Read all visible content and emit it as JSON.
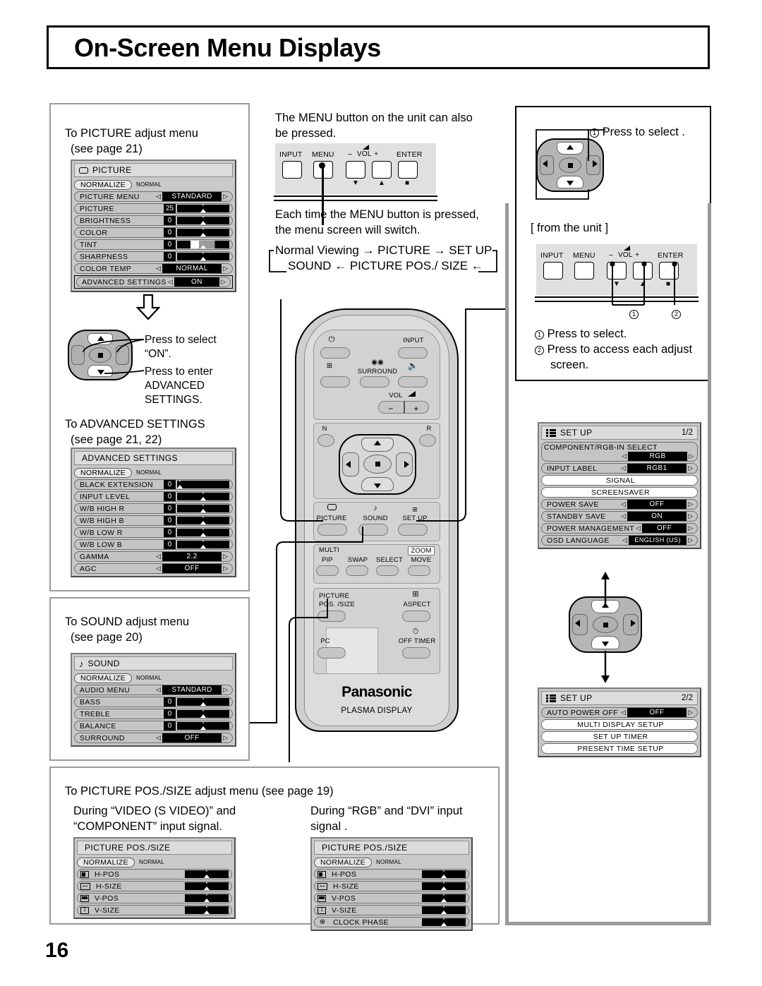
{
  "page": {
    "title": "On-Screen Menu Displays",
    "number": "16"
  },
  "left_column": {
    "picture_caption_l1": "To PICTURE adjust menu",
    "picture_caption_l2": "(see page 21)",
    "advanced_caption_l1": "To ADVANCED SETTINGS",
    "advanced_caption_l2": "(see page 21, 22)",
    "sound_caption_l1": "To SOUND adjust menu",
    "sound_caption_l2": "(see page 20)",
    "dpad_note_1": "Press to select",
    "dpad_note_2": "“ON”.",
    "dpad_note_3": "Press to enter",
    "dpad_note_4": "ADVANCED",
    "dpad_note_5": "SETTINGS."
  },
  "center_column": {
    "menu_note_l1": "The MENU button on the unit can also",
    "menu_note_l2": "be pressed.",
    "switch_note_l1": "Each time the MENU button is pressed,",
    "switch_note_l2": "the menu screen will switch.",
    "flow_line1": "Normal Viewing → PICTURE → SET UP",
    "flow_line2": "SOUND ← PICTURE POS./ SIZE ←"
  },
  "right_column": {
    "select_note": "Press to select .",
    "select_note_num": "1",
    "from_unit": "[ from the unit ]",
    "step1_num": "1",
    "step1": "Press to select.",
    "step2_num": "2",
    "step2_l1": "Press to access each adjust",
    "step2_l2": "screen.",
    "callout_1": "1",
    "callout_2": "2"
  },
  "bottom": {
    "caption": "To PICTURE POS./SIZE adjust menu (see page 19)",
    "left_note_l1": "During “VIDEO (S VIDEO)” and",
    "left_note_l2": "“COMPONENT” input signal.",
    "right_note_l1": "During “RGB” and “DVI” input",
    "right_note_l2": "signal ."
  },
  "unit_strip": {
    "labels": [
      "INPUT",
      "MENU",
      "VOL",
      "ENTER"
    ],
    "vol_minus": "−",
    "vol_plus": "+"
  },
  "osd": {
    "picture": {
      "title": "PICTURE",
      "normalize": "NORMALIZE",
      "normal_tag": "NORMAL",
      "rows": [
        {
          "label": "PICTURE  MENU",
          "type": "select",
          "value": "STANDARD"
        },
        {
          "label": "PICTURE",
          "type": "slider",
          "value": "25"
        },
        {
          "label": "BRIGHTNESS",
          "type": "slider",
          "value": "0"
        },
        {
          "label": "COLOR",
          "type": "slider",
          "value": "0"
        },
        {
          "label": "TINT",
          "type": "slider-tint",
          "value": "0"
        },
        {
          "label": "SHARPNESS",
          "type": "slider",
          "value": "0"
        },
        {
          "label": "COLOR  TEMP",
          "type": "select",
          "value": "NORMAL"
        },
        {
          "label": "ADVANCED  SETTINGS",
          "type": "select",
          "value": "ON",
          "highlight": true
        }
      ]
    },
    "advanced": {
      "title": "ADVANCED  SETTINGS",
      "normalize": "NORMALIZE",
      "normal_tag": "NORMAL",
      "rows": [
        {
          "label": "BLACK  EXTENSION",
          "type": "slider",
          "value": "0"
        },
        {
          "label": "INPUT LEVEL",
          "type": "slider",
          "value": "0"
        },
        {
          "label": "W/B  HIGH  R",
          "type": "slider",
          "value": "0"
        },
        {
          "label": "W/B  HIGH  B",
          "type": "slider",
          "value": "0"
        },
        {
          "label": "W/B  LOW  R",
          "type": "slider",
          "value": "0"
        },
        {
          "label": "W/B  LOW  B",
          "type": "slider",
          "value": "0"
        },
        {
          "label": "GAMMA",
          "type": "select",
          "value": "2.2"
        },
        {
          "label": "AGC",
          "type": "select",
          "value": "OFF"
        }
      ]
    },
    "sound": {
      "title": "SOUND",
      "normalize": "NORMALIZE",
      "normal_tag": "NORMAL",
      "rows": [
        {
          "label": "AUDIO  MENU",
          "type": "select",
          "value": "STANDARD"
        },
        {
          "label": "BASS",
          "type": "slider",
          "value": "0"
        },
        {
          "label": "TREBLE",
          "type": "slider",
          "value": "0"
        },
        {
          "label": "BALANCE",
          "type": "slider",
          "value": "0"
        },
        {
          "label": "SURROUND",
          "type": "select",
          "value": "OFF"
        }
      ]
    },
    "setup1": {
      "title": "SET UP",
      "page": "1/2",
      "rows": [
        {
          "label": "COMPONENT/RGB-IN  SELECT",
          "type": "select-tall",
          "value": "RGB"
        },
        {
          "label": "INPUT LABEL",
          "type": "select",
          "value": "RGB1"
        },
        {
          "label": "SIGNAL",
          "type": "plain"
        },
        {
          "label": "SCREENSAVER",
          "type": "plain"
        },
        {
          "label": "POWER SAVE",
          "type": "select",
          "value": "OFF"
        },
        {
          "label": "STANDBY SAVE",
          "type": "select",
          "value": "ON"
        },
        {
          "label": "POWER MANAGEMENT",
          "type": "select",
          "value": "OFF"
        },
        {
          "label": "OSD  LANGUAGE",
          "type": "select",
          "value": "ENGLISH (US)"
        }
      ]
    },
    "setup2": {
      "title": "SET UP",
      "page": "2/2",
      "rows": [
        {
          "label": "AUTO POWER OFF",
          "type": "select",
          "value": "OFF"
        },
        {
          "label": "MULTI DISPLAY SETUP",
          "type": "plain"
        },
        {
          "label": "SET UP TIMER",
          "type": "plain"
        },
        {
          "label": "PRESENT TIME SETUP",
          "type": "plain"
        }
      ]
    },
    "possize_video": {
      "title": "PICTURE  POS./SIZE",
      "normalize": "NORMALIZE",
      "normal_tag": "NORMAL",
      "rows": [
        {
          "label": "H-POS",
          "icon": "hpos-icon",
          "type": "bar"
        },
        {
          "label": "H-SIZE",
          "icon": "hsize-icon",
          "type": "bar"
        },
        {
          "label": "V-POS",
          "icon": "vpos-icon",
          "type": "bar"
        },
        {
          "label": "V-SIZE",
          "icon": "vsize-icon",
          "type": "bar"
        }
      ]
    },
    "possize_rgb": {
      "title": "PICTURE  POS./SIZE",
      "normalize": "NORMALIZE",
      "normal_tag": "NORMAL",
      "rows": [
        {
          "label": "H-POS",
          "icon": "hpos-icon",
          "type": "bar"
        },
        {
          "label": "H-SIZE",
          "icon": "hsize-icon",
          "type": "bar"
        },
        {
          "label": "V-POS",
          "icon": "vpos-icon",
          "type": "bar"
        },
        {
          "label": "V-SIZE",
          "icon": "vsize-icon",
          "type": "bar"
        },
        {
          "label": "CLOCK  PHASE",
          "icon": "clock-phase-icon",
          "type": "bar"
        }
      ]
    }
  },
  "remote": {
    "power_glyph": "⏻",
    "input": "INPUT",
    "surround": "SURROUND",
    "plus_box": "+",
    "mute_glyph": "Ø",
    "vol": "VOL",
    "vol_minus": "−",
    "vol_plus": "+",
    "n": "N",
    "r": "R",
    "picture": "PICTURE",
    "sound": "SOUND",
    "setup": "SET UP",
    "multi": "MULTI",
    "pip": "PIP",
    "swap": "SWAP",
    "select": "SELECT",
    "zoom": "ZOOM",
    "move": "MOVE",
    "picture_pos_l1": "PICTURE",
    "picture_pos_l2": "POS. /SIZE",
    "aspect": "ASPECT",
    "pc": "PC",
    "off_timer": "OFF TIMER",
    "brand": "Panasonic",
    "brand_sub": "PLASMA DISPLAY"
  }
}
